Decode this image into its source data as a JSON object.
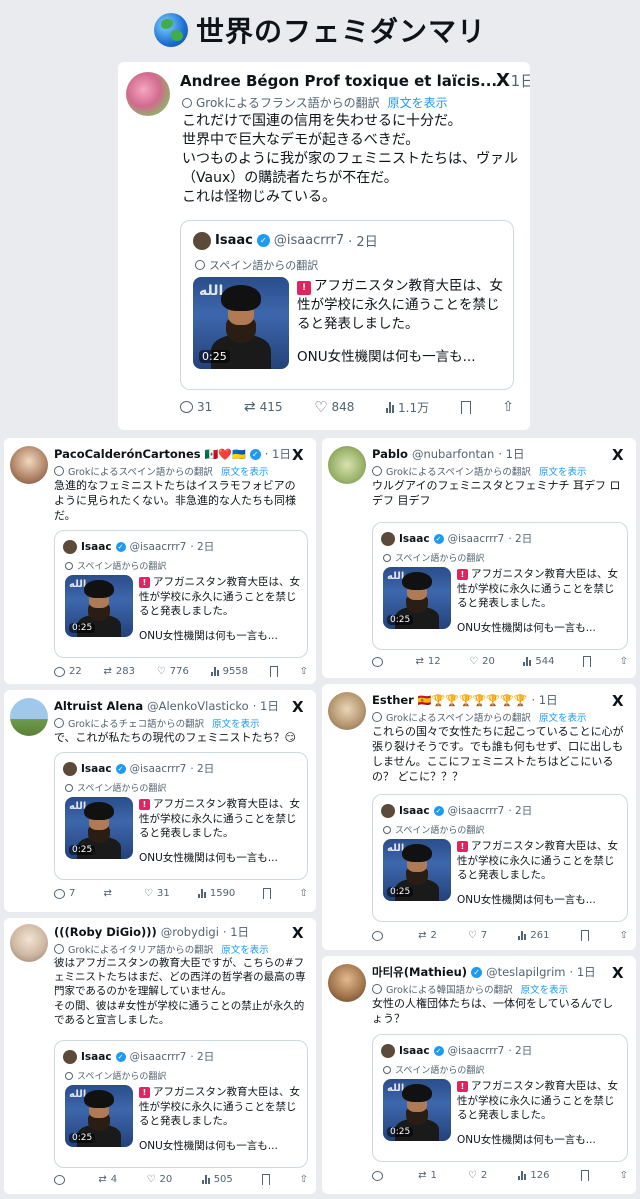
{
  "page_title": "世界のフェミダンマリ",
  "quoted": {
    "name": "Isaac",
    "handle": "@isaacrrr7",
    "time": "· 2日",
    "translation": "スペイン語からの翻訳",
    "line1": "アフガニスタン教育大臣は、女性が学校に永久に通うことを禁じると発表しました。",
    "line2": "ONU女性機関は何も一言も...",
    "video_duration": "0:25",
    "arabic": "الله",
    "siren": "🚨"
  },
  "x_logo": "X",
  "main": {
    "name": "Andree Bégon Prof toxique et laïcis...",
    "time": "· 1日",
    "translation": "Grokによるフランス語からの翻訳",
    "original": "原文を表示",
    "body": "これだけで国連の信用を失わせるに十分だ。\n世界中で巨大なデモが起きるべきだ。\nいつものように我が家のフェミニストたちは、ヴァル（Vaux）の購読者たちが不在だ。\nこれは怪物じみている。",
    "replies": "31",
    "reposts": "415",
    "likes": "848",
    "views": "1.1万"
  },
  "tweets": [
    {
      "name": "PacoCalderónCartones",
      "flags": "🇲🇽❤️🇺🇦",
      "time": "· 1日",
      "translation": "Grokによるスペイン語からの翻訳",
      "original": "原文を表示",
      "body": "急進的なフェミニストたちはイスラモフォビアのように見られたくない。非急進的な人たちも同様だ。",
      "replies": "22",
      "reposts": "283",
      "likes": "776",
      "views": "9558"
    },
    {
      "name": "Pablo",
      "handle": "@nubarfontan",
      "time": "· 1日",
      "translation": "Grokによるスペイン語からの翻訳",
      "original": "原文を表示",
      "body": "ウルグアイのフェミニスタとフェミナチ 耳デフ ロデフ 目デフ",
      "replies": "",
      "reposts": "12",
      "likes": "20",
      "views": "544"
    },
    {
      "name": "Altruist Alena",
      "handle": "@AlenkoVlasticko",
      "time": "· 1日",
      "translation": "Grokによるチェコ語からの翻訳",
      "original": "原文を表示",
      "body": "で、これが私たちの現代のフェミニストたち？😏",
      "replies": "7",
      "reposts": "",
      "likes": "31",
      "views": "1590"
    },
    {
      "name": "Esther",
      "flags": "🇪🇸🏆🏆🏆🏆🏆🏆🏆",
      "time": "· 1日",
      "translation": "Grokによるスペイン語からの翻訳",
      "original": "原文を表示",
      "body": "これらの国々で女性たちに起こっていることに心が張り裂けそうです。でも誰も何もせず、口に出しもしません。ここにフェミニストたちはどこにいるの？ どこに？？？",
      "replies": "",
      "reposts": "2",
      "likes": "7",
      "views": "261"
    },
    {
      "name": "(((Roby DiGio)))",
      "handle": "@robydigi",
      "time": "· 1日",
      "translation": "Grokによるイタリア語からの翻訳",
      "original": "原文を表示",
      "body": "彼はアフガニスタンの教育大臣ですが、こちらの#フェミニストたちはまだ、どの西洋の哲学者の最高の専門家であるのかを理解していません。\nその間、彼は#女性が学校に通うことの禁止が永久的であると宣言しました。",
      "replies": "",
      "reposts": "4",
      "likes": "20",
      "views": "505"
    },
    {
      "name": "마티유(Mathieu)",
      "handle": "@teslapilgrim",
      "time": "· 1日",
      "translation": "Grokによる韓国語からの翻訳",
      "original": "原文を表示",
      "body": "女性の人権団体たちは、一体何をしているんでしょう？",
      "replies": "",
      "reposts": "1",
      "likes": "2",
      "views": "126"
    }
  ]
}
